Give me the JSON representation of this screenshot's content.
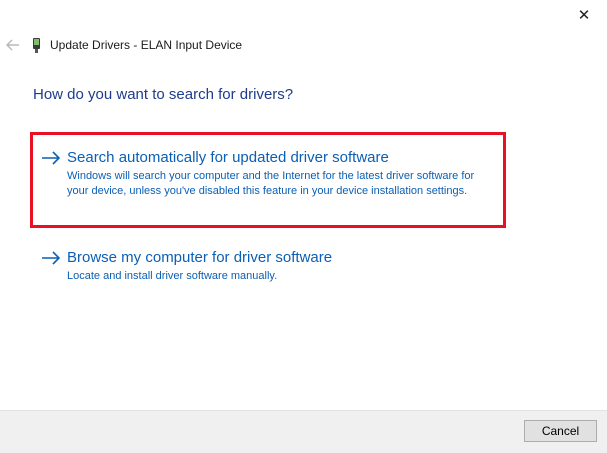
{
  "window": {
    "close_glyph": "✕",
    "header_title": "Update Drivers - ELAN Input Device"
  },
  "main": {
    "heading": "How do you want to search for drivers?",
    "options": [
      {
        "title": "Search automatically for updated driver software",
        "description": "Windows will search your computer and the Internet for the latest driver software for your device, unless you've disabled this feature in your device installation settings.",
        "highlighted": true
      },
      {
        "title": "Browse my computer for driver software",
        "description": "Locate and install driver software manually.",
        "highlighted": false
      }
    ]
  },
  "footer": {
    "cancel_label": "Cancel"
  },
  "colors": {
    "link_blue": "#0b5fb4",
    "heading_blue": "#1e3c8c",
    "highlight_red": "#e81123",
    "footer_bg": "#f0f0f0"
  },
  "icons": {
    "back": "back-arrow-icon",
    "device": "device-icon",
    "option_arrow": "arrow-right-icon",
    "close": "close-icon"
  }
}
